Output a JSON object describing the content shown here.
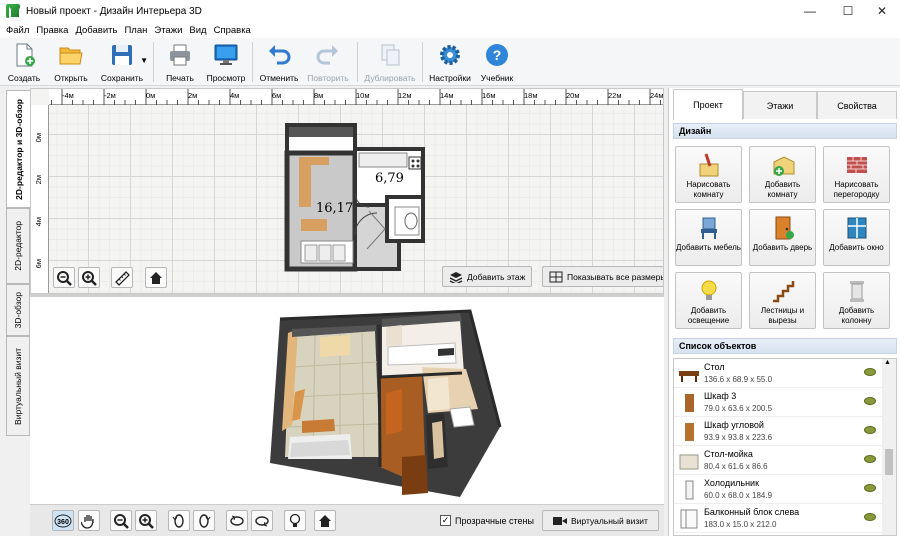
{
  "window": {
    "title": "Новый проект - Дизайн Интерьера 3D",
    "min": "—",
    "max": "☐",
    "close": "✕"
  },
  "menu": [
    "Файл",
    "Правка",
    "Добавить",
    "План",
    "Этажи",
    "Вид",
    "Справка"
  ],
  "toolbar": [
    {
      "label": "Создать",
      "icon": "new-doc-icon",
      "enabled": true
    },
    {
      "label": "Открыть",
      "icon": "folder-icon",
      "enabled": true
    },
    {
      "label": "Сохранить",
      "icon": "floppy-icon",
      "enabled": true
    },
    {
      "label": "Печать",
      "icon": "printer-icon",
      "enabled": true
    },
    {
      "label": "Просмотр",
      "icon": "monitor-icon",
      "enabled": true
    },
    {
      "label": "Отменить",
      "icon": "undo-icon",
      "enabled": true
    },
    {
      "label": "Повторить",
      "icon": "redo-icon",
      "enabled": false
    },
    {
      "label": "Дублировать",
      "icon": "duplicate-icon",
      "enabled": false
    },
    {
      "label": "Настройки",
      "icon": "gear-icon",
      "enabled": true
    },
    {
      "label": "Учебник",
      "icon": "help-icon",
      "enabled": true
    }
  ],
  "side_tabs": [
    "2D-редактор и 3D-обзор",
    "2D-редактор",
    "3D-обзор",
    "Виртуальный визит"
  ],
  "ruler_h": [
    "-4м",
    "-2м",
    "0м",
    "2м",
    "4м",
    "6м",
    "8м",
    "10м",
    "12м",
    "14м",
    "16м",
    "18м",
    "20м",
    "22м",
    "24м"
  ],
  "ruler_v": [
    "0м",
    "2м",
    "4м",
    "6м"
  ],
  "plan": {
    "room1_area": "16,17",
    "room2_area": "6,79"
  },
  "editor_buttons": {
    "add_floor": "Добавить этаж",
    "show_sizes": "Показывать все размеры"
  },
  "bottom": {
    "transparent_walls": "Прозрачные стены",
    "transparent_checked": true,
    "virtual_visit": "Виртуальный визит"
  },
  "right_tabs": [
    "Проект",
    "Этажи",
    "Свойства"
  ],
  "design_header": "Дизайн",
  "design_buttons": [
    {
      "label": "Нарисовать комнату",
      "icon": "draw-room-icon"
    },
    {
      "label": "Добавить комнату",
      "icon": "add-room-icon"
    },
    {
      "label": "Нарисовать перегородку",
      "icon": "brick-wall-icon"
    },
    {
      "label": "Добавить мебель",
      "icon": "chair-icon"
    },
    {
      "label": "Добавить дверь",
      "icon": "door-icon"
    },
    {
      "label": "Добавить окно",
      "icon": "window-icon"
    },
    {
      "label": "Добавить освещение",
      "icon": "bulb-icon"
    },
    {
      "label": "Лестницы и вырезы",
      "icon": "stairs-icon"
    },
    {
      "label": "Добавить колонну",
      "icon": "column-icon"
    }
  ],
  "objects_header": "Список объектов",
  "objects": [
    {
      "name": "Стол",
      "dims": "136.6 x 68.9 x 55.0"
    },
    {
      "name": "Шкаф 3",
      "dims": "79.0 x 63.6 x 200.5"
    },
    {
      "name": "Шкаф угловой",
      "dims": "93.9 x 93.8 x 223.6"
    },
    {
      "name": "Стол-мойка",
      "dims": "80.4 x 61.6 x 86.6"
    },
    {
      "name": "Холодильник",
      "dims": "60.0 x 68.0 x 184.9"
    },
    {
      "name": "Балконный блок слева",
      "dims": "183.0 x 15.0 x 212.0"
    }
  ]
}
